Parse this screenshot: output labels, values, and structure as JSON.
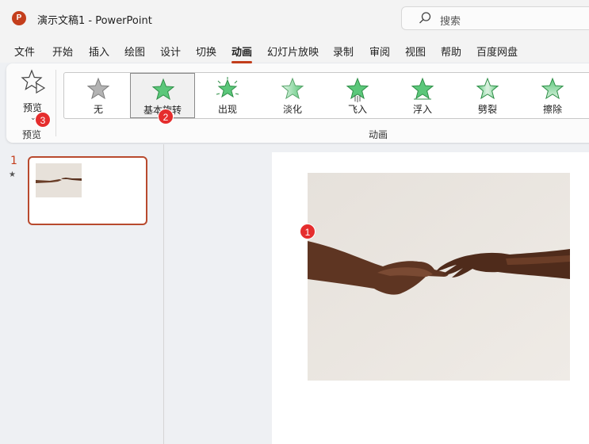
{
  "app": {
    "logo_letter": "P",
    "title": "演示文稿1  -  PowerPoint",
    "brand_color": "#c43e1c"
  },
  "search": {
    "placeholder": "搜索",
    "icon": "search-icon"
  },
  "menu": {
    "tabs": [
      {
        "label": "文件"
      },
      {
        "label": "开始"
      },
      {
        "label": "插入"
      },
      {
        "label": "绘图"
      },
      {
        "label": "设计"
      },
      {
        "label": "切换"
      },
      {
        "label": "动画",
        "active": true
      },
      {
        "label": "幻灯片放映"
      },
      {
        "label": "录制"
      },
      {
        "label": "审阅"
      },
      {
        "label": "视图"
      },
      {
        "label": "帮助"
      },
      {
        "label": "百度网盘"
      }
    ]
  },
  "ribbon": {
    "preview": {
      "label": "预览",
      "group_label": "预览",
      "icon": "star-play-icon"
    },
    "animations": {
      "group_label": "动画",
      "items": [
        {
          "label": "无",
          "icon": "star-gray-icon"
        },
        {
          "label": "基本旋转",
          "icon": "star-green-icon",
          "selected": true
        },
        {
          "label": "出现",
          "icon": "star-burst-icon"
        },
        {
          "label": "淡化",
          "icon": "star-fade-icon"
        },
        {
          "label": "飞入",
          "icon": "star-fly-icon"
        },
        {
          "label": "浮入",
          "icon": "star-float-icon"
        },
        {
          "label": "劈裂",
          "icon": "star-split-icon"
        },
        {
          "label": "擦除",
          "icon": "star-wipe-icon"
        }
      ]
    }
  },
  "badges": [
    "1",
    "2",
    "3"
  ],
  "thumbnails": [
    {
      "number": "1",
      "has_animation": "★"
    }
  ],
  "colors": {
    "accent": "#c43e1c",
    "badge": "#e52d2d",
    "star_green": "#3fb85e"
  }
}
